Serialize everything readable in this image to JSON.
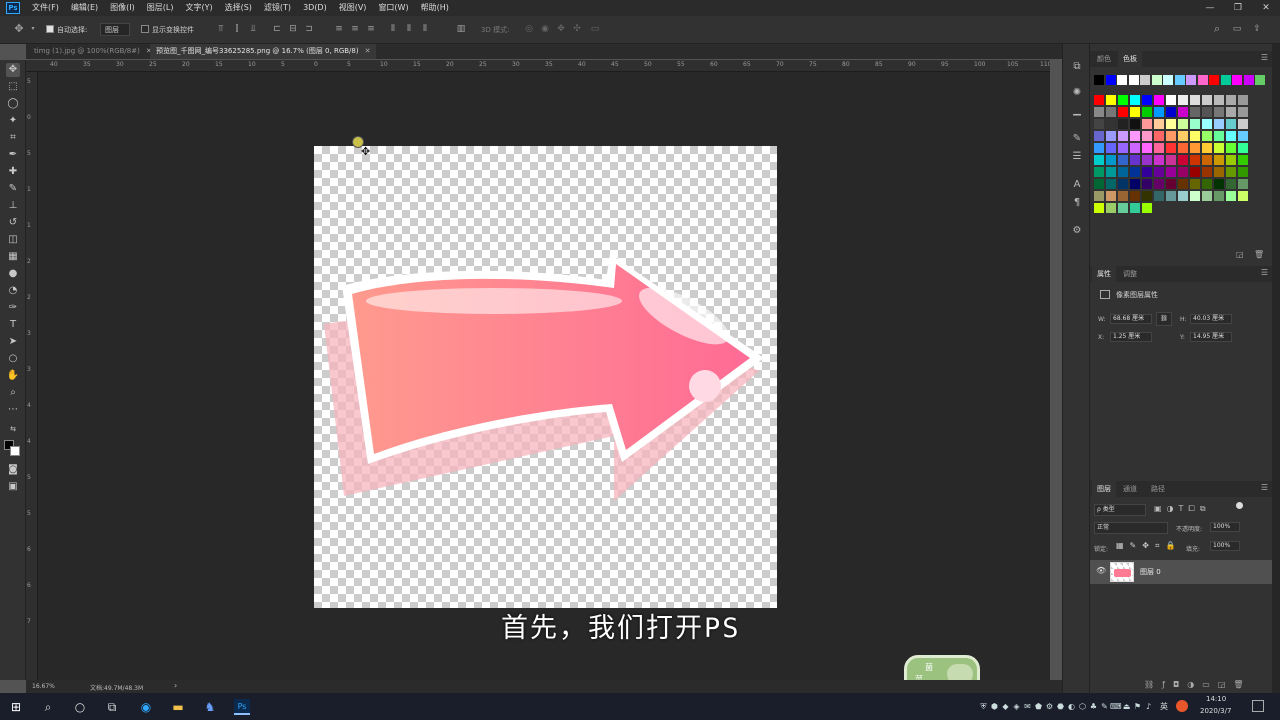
{
  "app": {
    "logo": "Ps"
  },
  "menu": [
    "文件(F)",
    "编辑(E)",
    "图像(I)",
    "图层(L)",
    "文字(Y)",
    "选择(S)",
    "滤镜(T)",
    "3D(D)",
    "视图(V)",
    "窗口(W)",
    "帮助(H)"
  ],
  "window_controls": {
    "minimize": "—",
    "restore": "❐",
    "close": "✕"
  },
  "options": {
    "auto_select_label": "自动选择:",
    "auto_select_value": "图层",
    "show_transform_label": "显示变换控件",
    "mode_3d_label": "3D 模式:"
  },
  "tabs": [
    {
      "label": "timg (1).jpg @ 100%(RGB/8#)",
      "close": "✕"
    },
    {
      "label": "预览图_千图网_编号33625285.png @ 16.7% (图层 0, RGB/8)",
      "close": "✕"
    }
  ],
  "ruler_h": [
    "40",
    "35",
    "30",
    "25",
    "20",
    "15",
    "10",
    "5",
    "0",
    "5",
    "10",
    "15",
    "20",
    "25",
    "30",
    "35",
    "40",
    "45",
    "50",
    "55",
    "60",
    "65",
    "70",
    "75",
    "80",
    "85",
    "90",
    "95",
    "100",
    "105",
    "110"
  ],
  "ruler_v": [
    "5",
    "0",
    "5",
    "1",
    "1",
    "2",
    "2",
    "3",
    "3",
    "4",
    "4",
    "5",
    "5",
    "6",
    "6",
    "7"
  ],
  "subtitle": "首先，我们打开PS",
  "watermark": {
    "line1": "菌",
    "line2": "菜"
  },
  "status": {
    "zoom": "16.67%",
    "doc": "文档:49.7M/48.3M",
    "arrow": "›"
  },
  "swatches_panel": {
    "tabs": [
      "颜色",
      "色板"
    ],
    "colors_row1": [
      "#000000",
      "#0000ff",
      "#ffffff",
      "#ffffff",
      "#cccccc",
      "#ccffcc",
      "#ccffff",
      "#66ccff",
      "#cc99ff",
      "#ff66cc",
      "#ff0000",
      "#00cc99",
      "#ff00ff",
      "#cc00ff",
      "#66cc66"
    ],
    "colors_grid": [
      [
        "#ff0000",
        "#ffff00",
        "#00ff00",
        "#00ffff",
        "#0000ff",
        "#ff00ff",
        "#ffffff",
        "#eeeeee",
        "#dddddd",
        "#cccccc",
        "#bbbbbb",
        "#aaaaaa",
        "#999999"
      ],
      [
        "#888888",
        "#777777",
        "#ff0000",
        "#ffff00",
        "#00cc00",
        "#0099ff",
        "#0000cc",
        "#cc00cc",
        "#666666",
        "#555555",
        "#777777",
        "#aaaaaa",
        "#999999"
      ],
      [
        "#444444",
        "#333333",
        "#222222",
        "#111111",
        "#ff9999",
        "#ffcc99",
        "#ffff99",
        "#ccff99",
        "#99ffcc",
        "#99ffff",
        "#99ccff",
        "#66cccc",
        "#cccccc"
      ],
      [
        "#6666cc",
        "#9999ff",
        "#cc99ff",
        "#ff99ff",
        "#ff99cc",
        "#ff6666",
        "#ff9966",
        "#ffcc66",
        "#ffff66",
        "#99ff66",
        "#66ff99",
        "#66ffff",
        "#66ccff"
      ],
      [
        "#3399ff",
        "#6666ff",
        "#9966ff",
        "#cc66ff",
        "#ff66ff",
        "#ff6699",
        "#ff3333",
        "#ff6633",
        "#ff9933",
        "#ffcc33",
        "#ccff33",
        "#66ff33",
        "#33ff99"
      ],
      [
        "#00cccc",
        "#0099cc",
        "#3366cc",
        "#6633cc",
        "#9933cc",
        "#cc33cc",
        "#cc3399",
        "#cc0033",
        "#cc3300",
        "#cc6600",
        "#cc9900",
        "#99cc00",
        "#33cc00"
      ],
      [
        "#009966",
        "#009999",
        "#006699",
        "#003399",
        "#330099",
        "#660099",
        "#990099",
        "#990066",
        "#990000",
        "#993300",
        "#996600",
        "#669900",
        "#339900"
      ],
      [
        "#006633",
        "#006666",
        "#003366",
        "#000066",
        "#330066",
        "#660066",
        "#660033",
        "#663300",
        "#666600",
        "#336600",
        "#003300",
        "#336633",
        "#669966"
      ],
      [
        "#999966",
        "#cc9966",
        "#996633",
        "#663300",
        "#333300",
        "#336666",
        "#669999",
        "#99cccc",
        "#ccffcc",
        "#99cc99",
        "#669966",
        "#99ff99",
        "#ccff66"
      ],
      [
        "#ccff00",
        "#99cc66",
        "#66cc99",
        "#33cc99",
        "#99ff00"
      ]
    ]
  },
  "properties_panel": {
    "tabs": [
      "属性",
      "调整"
    ],
    "layer_type": "像素图层属性",
    "w_label": "W:",
    "w_value": "68.68 厘米",
    "h_label": "H:",
    "h_value": "40.03 厘米",
    "x_label": "X:",
    "x_value": "1.25 厘米",
    "y_label": "Y:",
    "y_value": "14.95 厘米",
    "link": "⛓"
  },
  "layers_panel": {
    "tabs": [
      "图层",
      "通道",
      "路径"
    ],
    "filter": "ρ 类型",
    "blend_mode": "正常",
    "opacity_label": "不透明度:",
    "opacity_value": "100%",
    "lock_label": "锁定:",
    "fill_label": "填充:",
    "fill_value": "100%",
    "layer_name": "图层 0"
  },
  "taskbar": {
    "time": "14:10",
    "date": "2020/3/7",
    "ime": "英",
    "tray_items": [
      "⛨",
      "⬢",
      "◆",
      "◈",
      "✉",
      "⬟",
      "⚙",
      "⬣",
      "◐",
      "⬡",
      "♣",
      "✎",
      "⌨",
      "⏏",
      "⚑",
      "♪"
    ]
  }
}
